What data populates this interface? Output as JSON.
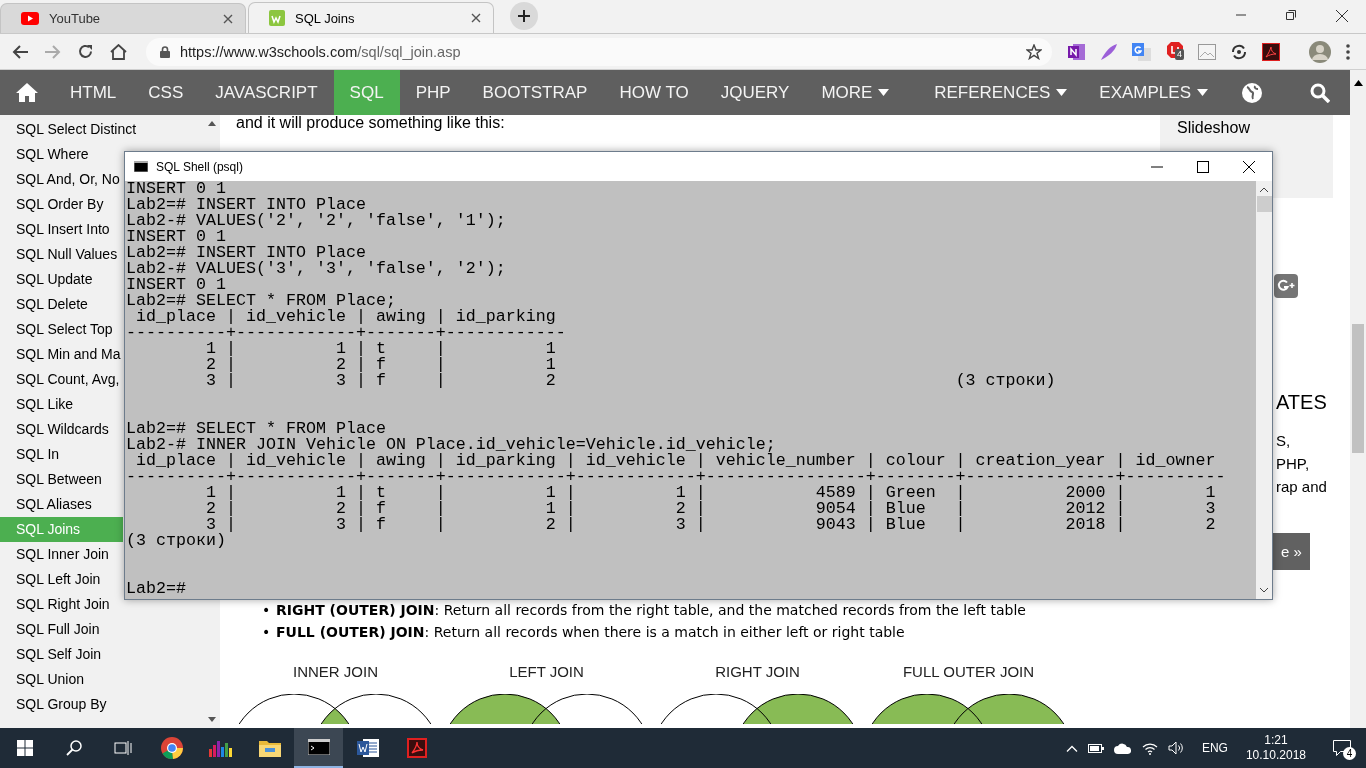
{
  "browser": {
    "tabs": [
      {
        "title": "YouTube",
        "kind": "video",
        "selected": false
      },
      {
        "title": "SQL Joins",
        "kind": "site",
        "selected": true
      }
    ],
    "url": "https://www.w3schools.com/sql/sql_join.asp",
    "extension_badge": "4"
  },
  "nav": {
    "items": [
      {
        "label": "HTML",
        "selected": false,
        "dropdown": false
      },
      {
        "label": "CSS",
        "selected": false,
        "dropdown": false
      },
      {
        "label": "JAVASCRIPT",
        "selected": false,
        "dropdown": false
      },
      {
        "label": "SQL",
        "selected": true,
        "dropdown": false
      },
      {
        "label": "PHP",
        "selected": false,
        "dropdown": false
      },
      {
        "label": "BOOTSTRAP",
        "selected": false,
        "dropdown": false
      },
      {
        "label": "HOW TO",
        "selected": false,
        "dropdown": false
      },
      {
        "label": "JQUERY",
        "selected": false,
        "dropdown": false
      },
      {
        "label": "MORE",
        "selected": false,
        "dropdown": true
      }
    ],
    "right_items": [
      {
        "label": "REFERENCES",
        "selected": false,
        "dropdown": true
      },
      {
        "label": "EXAMPLES",
        "selected": false,
        "dropdown": true
      }
    ]
  },
  "sidebar": {
    "items": [
      {
        "label": "SQL Select Distinct",
        "selected": false
      },
      {
        "label": "SQL Where",
        "selected": false
      },
      {
        "label": "SQL And, Or, No",
        "selected": false
      },
      {
        "label": "SQL Order By",
        "selected": false
      },
      {
        "label": "SQL Insert Into",
        "selected": false
      },
      {
        "label": "SQL Null Values",
        "selected": false
      },
      {
        "label": "SQL Update",
        "selected": false
      },
      {
        "label": "SQL Delete",
        "selected": false
      },
      {
        "label": "SQL Select Top",
        "selected": false
      },
      {
        "label": "SQL Min and Ma",
        "selected": false
      },
      {
        "label": "SQL Count, Avg,",
        "selected": false
      },
      {
        "label": "SQL Like",
        "selected": false
      },
      {
        "label": "SQL Wildcards",
        "selected": false
      },
      {
        "label": "SQL In",
        "selected": false
      },
      {
        "label": "SQL Between",
        "selected": false
      },
      {
        "label": "SQL Aliases",
        "selected": false
      },
      {
        "label": "SQL Joins",
        "selected": true
      },
      {
        "label": "SQL Inner Join",
        "selected": false
      },
      {
        "label": "SQL Left Join",
        "selected": false
      },
      {
        "label": "SQL Right Join",
        "selected": false
      },
      {
        "label": "SQL Full Join",
        "selected": false
      },
      {
        "label": "SQL Self Join",
        "selected": false
      },
      {
        "label": "SQL Union",
        "selected": false
      },
      {
        "label": "SQL Group By",
        "selected": false
      }
    ]
  },
  "page": {
    "intro": "and it will produce something like this:",
    "bullets": [
      {
        "marker": "•",
        "text": "**RIGHT (OUTER) JOIN**: Return all records from the right table, and the matched records from the left table"
      },
      {
        "marker": "•",
        "text": "**FULL (OUTER) JOIN**: Return all records when there is a match in either left or right table"
      }
    ],
    "diagrams": [
      {
        "label": "INNER JOIN",
        "kind": "inner"
      },
      {
        "label": "LEFT JOIN",
        "kind": "left"
      },
      {
        "label": "RIGHT JOIN",
        "kind": "right"
      },
      {
        "label": "FULL OUTER JOIN",
        "kind": "full"
      }
    ]
  },
  "right_panel": {
    "menu_items": [
      "Slideshow"
    ],
    "heading": "ATES",
    "lines": [
      "S,",
      "PHP,",
      "rap and"
    ],
    "button": "e »"
  },
  "terminal": {
    "title": "SQL Shell (psql)",
    "lines": [
      {
        "kind": "text",
        "text": "INSERT 0 1"
      },
      {
        "kind": "text",
        "text": "Lab2=# INSERT INTO Place"
      },
      {
        "kind": "text",
        "text": "Lab2-# VALUES('2', '2', 'false', '1');"
      },
      {
        "kind": "text",
        "text": "INSERT 0 1"
      },
      {
        "kind": "text",
        "text": "Lab2=# INSERT INTO Place"
      },
      {
        "kind": "text",
        "text": "Lab2-# VALUES('3', '3', 'false', '2');"
      },
      {
        "kind": "text",
        "text": "INSERT 0 1"
      },
      {
        "kind": "text",
        "text": "Lab2=# SELECT * FROM Place;"
      },
      {
        "kind": "text",
        "text": " id_place | id_vehicle | awing | id_parking"
      },
      {
        "kind": "text",
        "text": "----------+------------+-------+------------"
      },
      {
        "kind": "text",
        "text": "        1 |          1 | t     |          1"
      },
      {
        "kind": "text",
        "text": "        2 |          2 | f     |          1"
      },
      {
        "kind": "text",
        "text": "        3 |          3 | f     |          2",
        "aside": "(3 строки)"
      },
      {
        "kind": "blank"
      },
      {
        "kind": "blank"
      },
      {
        "kind": "text",
        "text": "Lab2=# SELECT * FROM Place"
      },
      {
        "kind": "text",
        "text": "Lab2-# INNER JOIN Vehicle ON Place.id_vehicle=Vehicle.id_vehicle;"
      },
      {
        "kind": "text",
        "text": " id_place | id_vehicle | awing | id_parking | id_vehicle | vehicle_number | colour | creation_year | id_owner"
      },
      {
        "kind": "text",
        "text": "----------+------------+-------+------------+------------+----------------+--------+---------------+----------"
      },
      {
        "kind": "text",
        "text": "        1 |          1 | t     |          1 |          1 |           4589 | Green  |          2000 |        1"
      },
      {
        "kind": "text",
        "text": "        2 |          2 | f     |          1 |          2 |           9054 | Blue   |          2012 |        3"
      },
      {
        "kind": "text",
        "text": "        3 |          3 | f     |          2 |          3 |           9043 | Blue   |          2018 |        2"
      },
      {
        "kind": "text",
        "text": "(3 строки)"
      },
      {
        "kind": "blank"
      },
      {
        "kind": "blank"
      },
      {
        "kind": "text",
        "text": "Lab2=#"
      }
    ]
  },
  "taskbar": {
    "pinned": [
      {
        "kind": "browser",
        "active": false
      },
      {
        "kind": "equalizer",
        "active": false
      },
      {
        "kind": "folder",
        "active": false
      },
      {
        "kind": "terminal",
        "active": true
      },
      {
        "kind": "word",
        "active": false
      },
      {
        "kind": "pdf",
        "active": false
      }
    ],
    "language": "ENG",
    "time": "1:21",
    "date": "10.10.2018",
    "notifications": "4"
  }
}
